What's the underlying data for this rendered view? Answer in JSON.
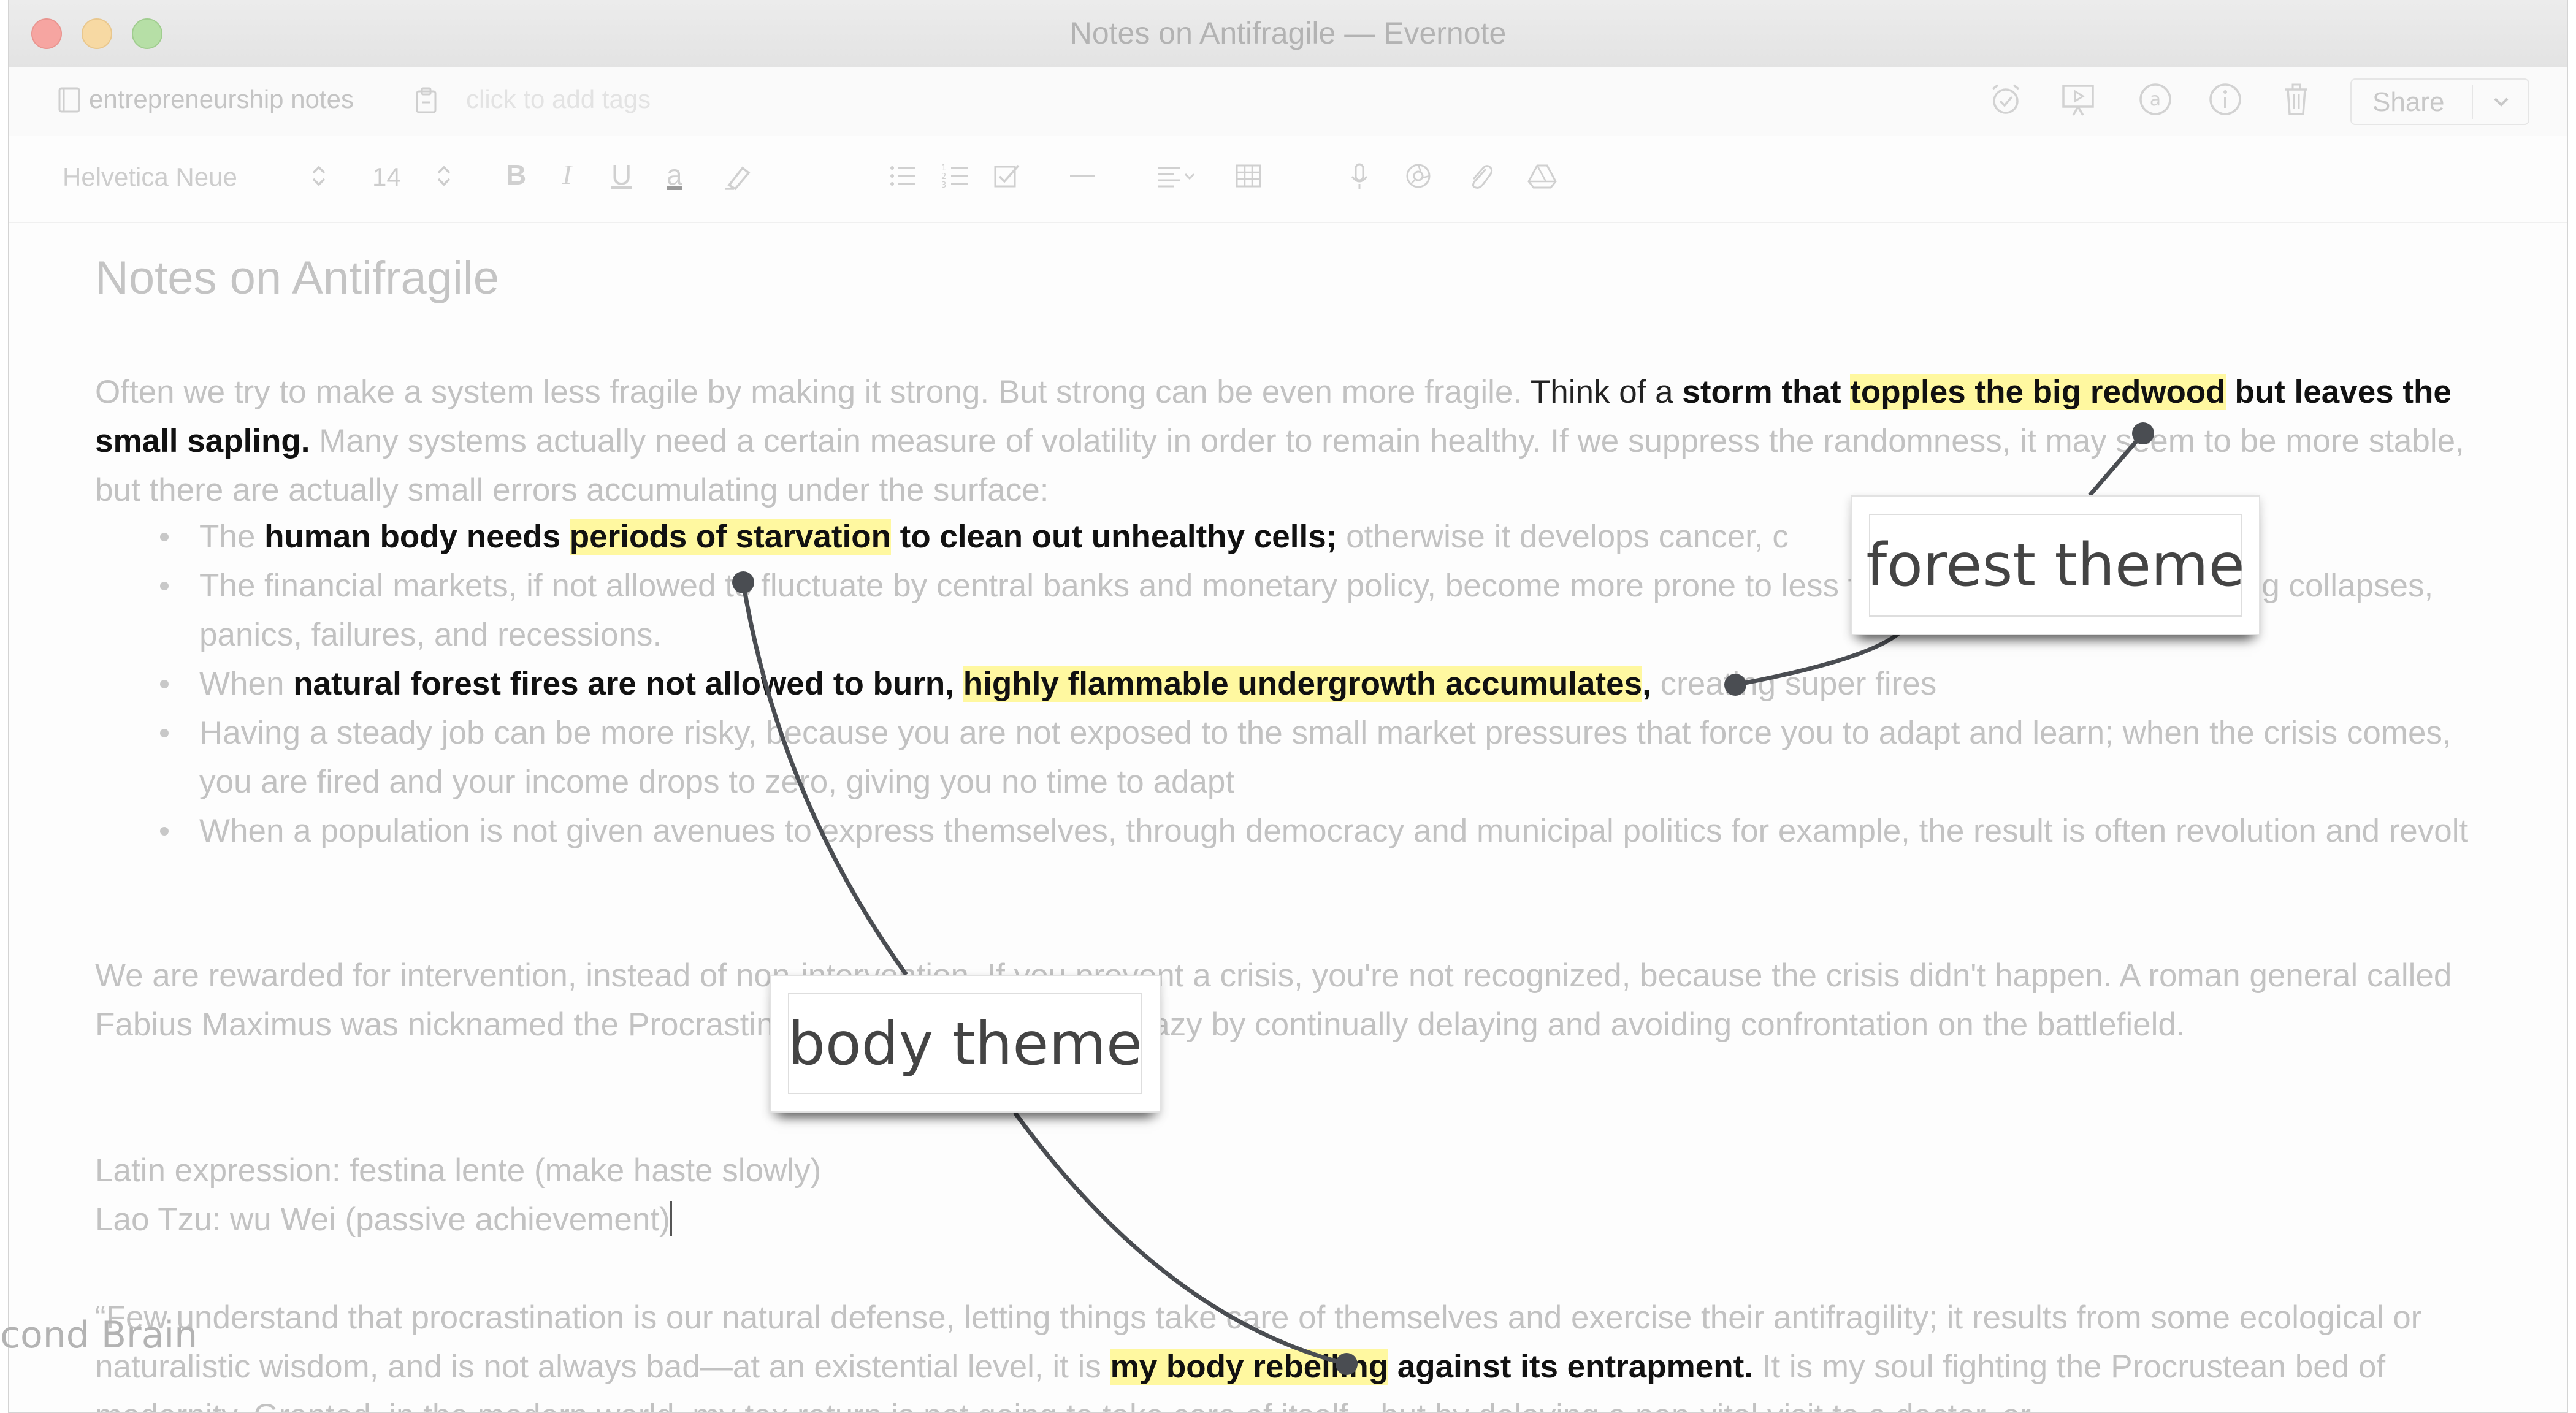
{
  "window": {
    "title": "Notes on Antifragile — Evernote"
  },
  "notebar": {
    "notebook": "entrepreneurship notes",
    "tags_placeholder": "click to add tags",
    "share_label": "Share"
  },
  "format": {
    "font": "Helvetica Neue",
    "size": "14",
    "bold": "B",
    "italic": "I",
    "underline": "U",
    "color_letter": "a"
  },
  "note": {
    "title": "Notes on Antifragile",
    "p1": {
      "a": "Often we try to make a system less fragile by making it strong. But strong can be even more fragile. ",
      "b": "Think of a ",
      "c": "storm that",
      "d": " ",
      "e": "topples the big redwood",
      "f": " but leaves the small sapling.",
      "g": " Many systems actually need a certain measure of volatility in order to remain healthy. If we suppress the randomness, it may seem to be more stable, but there are actually small errors accumulating under the surface:"
    },
    "b1": {
      "a": "The ",
      "b": "human body needs ",
      "c": "periods of starvation",
      "d": " to clean out unhealthy cells;",
      "e": " otherwise it develops cancer, c"
    },
    "b2": "The financial markets, if not allowed to fluctuate by central banks and monetary policy, become more prone to less frequent but more devastating collapses, panics, failures, and recessions.",
    "b3": {
      "a": "When ",
      "b": "natural forest fires are not allowed to burn,",
      "c": " ",
      "d": "highly flammable undergrowth accumulates",
      "e": ",",
      "f": " creating super fires"
    },
    "b4": "Having a steady job can be more risky, because you are not exposed to the small market pressures that force you to adapt and learn; when the crisis comes, you are fired and your income drops to zero, giving you no time to adapt",
    "b5": "When a population is not given avenues to express themselves, through democracy and municipal politics for example, the result is often revolution and revolt",
    "p2": "We are rewarded for intervention, instead of non-intervention. If you prevent a crisis, you're not recognized, because the crisis didn't happen. A roman general called Fabius Maximus was nicknamed the Procrastinator. He drove Hannibal crazy by continually delaying and avoiding confrontation on the battlefield.",
    "p3": "Latin expression: festina lente (make haste slowly)",
    "p4": "Lao Tzu: wu Wei (passive achievement)",
    "p5": {
      "a": "“Few understand that procrastination is our natural defense, letting things take care of themselves and exercise their antifragility; it results from some ecological or naturalistic wisdom, and is not always bad—at an existential level, it is ",
      "b": "my body rebelling",
      "c": " against its entrapment.",
      "d": " It is my soul fighting the Procrustean bed of modernity. Granted, in the modern world, my tax return is not going to take care of itself—but by delaying a non-vital visit to a doctor, or"
    }
  },
  "callouts": {
    "forest": "forest theme",
    "body": "body theme"
  },
  "side_label": "cond Brain",
  "colors": {
    "highlight": "#fff8a0",
    "annotation_line": "#4a4d52",
    "callout_text": "#444444"
  }
}
